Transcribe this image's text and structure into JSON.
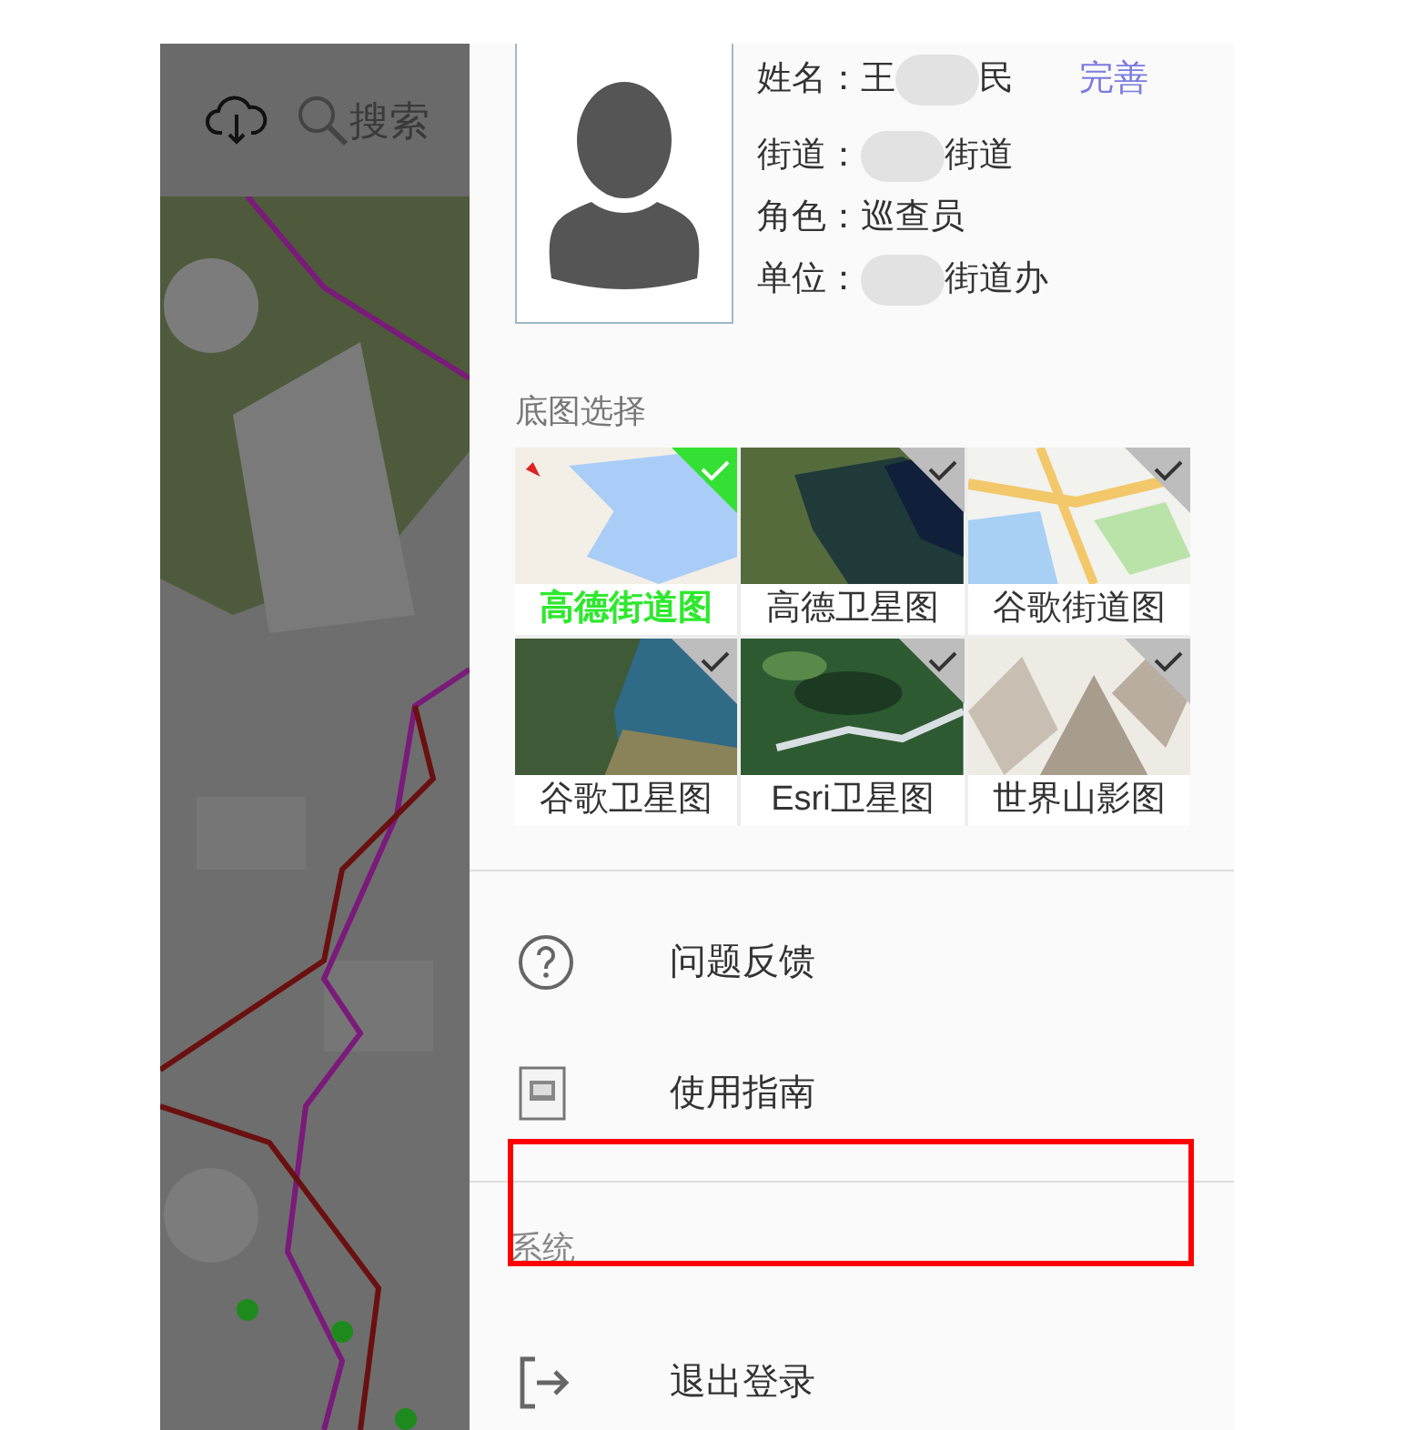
{
  "top_bar": {
    "search_text": "搜索"
  },
  "profile": {
    "rows": [
      {
        "label": "姓名：",
        "before": "王",
        "after": "民",
        "redacted": true,
        "action": "完善"
      },
      {
        "label": "街道：",
        "before": "",
        "after": "街道",
        "redacted": true
      },
      {
        "label": "角色：",
        "before": "巡查员",
        "after": "",
        "redacted": false
      },
      {
        "label": "单位：",
        "before": "",
        "after": "街道办",
        "redacted": true
      }
    ]
  },
  "basemap": {
    "title": "底图选择",
    "tiles": [
      {
        "label": "高德街道图",
        "selected": true
      },
      {
        "label": "高德卫星图",
        "selected": false
      },
      {
        "label": "谷歌街道图",
        "selected": false
      },
      {
        "label": "谷歌卫星图",
        "selected": false
      },
      {
        "label": "Esri卫星图",
        "selected": false
      },
      {
        "label": "世界山影图",
        "selected": false
      }
    ]
  },
  "menu": [
    {
      "kind": "help",
      "label": "问题反馈"
    },
    {
      "kind": "guide",
      "label": "使用指南"
    }
  ],
  "system": {
    "title": "系统",
    "highlighted": true,
    "items": [
      {
        "kind": "logout",
        "label": "退出登录"
      }
    ]
  }
}
